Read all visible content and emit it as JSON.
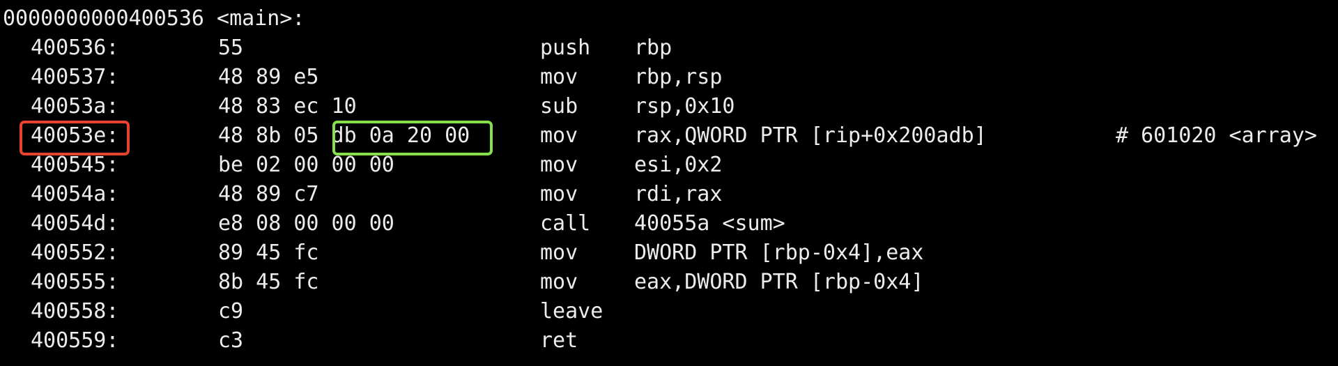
{
  "terminal": {
    "header": "0000000000400536 <main>:",
    "highlight_colors": {
      "address_box": "#e8432d",
      "bytes_box": "#83e04a"
    },
    "lines": [
      {
        "addr": "400536:",
        "bytes": "55",
        "mnemonic": "push",
        "operands": "rbp",
        "comment": ""
      },
      {
        "addr": "400537:",
        "bytes": "48 89 e5",
        "mnemonic": "mov",
        "operands": "rbp,rsp",
        "comment": ""
      },
      {
        "addr": "40053a:",
        "bytes": "48 83 ec 10",
        "mnemonic": "sub",
        "operands": "rsp,0x10",
        "comment": ""
      },
      {
        "addr": "40053e:",
        "bytes": "48 8b 05 db 0a 20 00",
        "mnemonic": "mov",
        "operands": "rax,QWORD PTR [rip+0x200adb]",
        "comment": "# 601020 <array>"
      },
      {
        "addr": "400545:",
        "bytes": "be 02 00 00 00",
        "mnemonic": "mov",
        "operands": "esi,0x2",
        "comment": ""
      },
      {
        "addr": "40054a:",
        "bytes": "48 89 c7",
        "mnemonic": "mov",
        "operands": "rdi,rax",
        "comment": ""
      },
      {
        "addr": "40054d:",
        "bytes": "e8 08 00 00 00",
        "mnemonic": "call",
        "operands": "40055a <sum>",
        "comment": ""
      },
      {
        "addr": "400552:",
        "bytes": "89 45 fc",
        "mnemonic": "mov",
        "operands": "DWORD PTR [rbp-0x4],eax",
        "comment": ""
      },
      {
        "addr": "400555:",
        "bytes": "8b 45 fc",
        "mnemonic": "mov",
        "operands": "eax,DWORD PTR [rbp-0x4]",
        "comment": ""
      },
      {
        "addr": "400558:",
        "bytes": "c9",
        "mnemonic": "leave",
        "operands": "",
        "comment": ""
      },
      {
        "addr": "400559:",
        "bytes": "c3",
        "mnemonic": "ret",
        "operands": "",
        "comment": ""
      }
    ]
  }
}
